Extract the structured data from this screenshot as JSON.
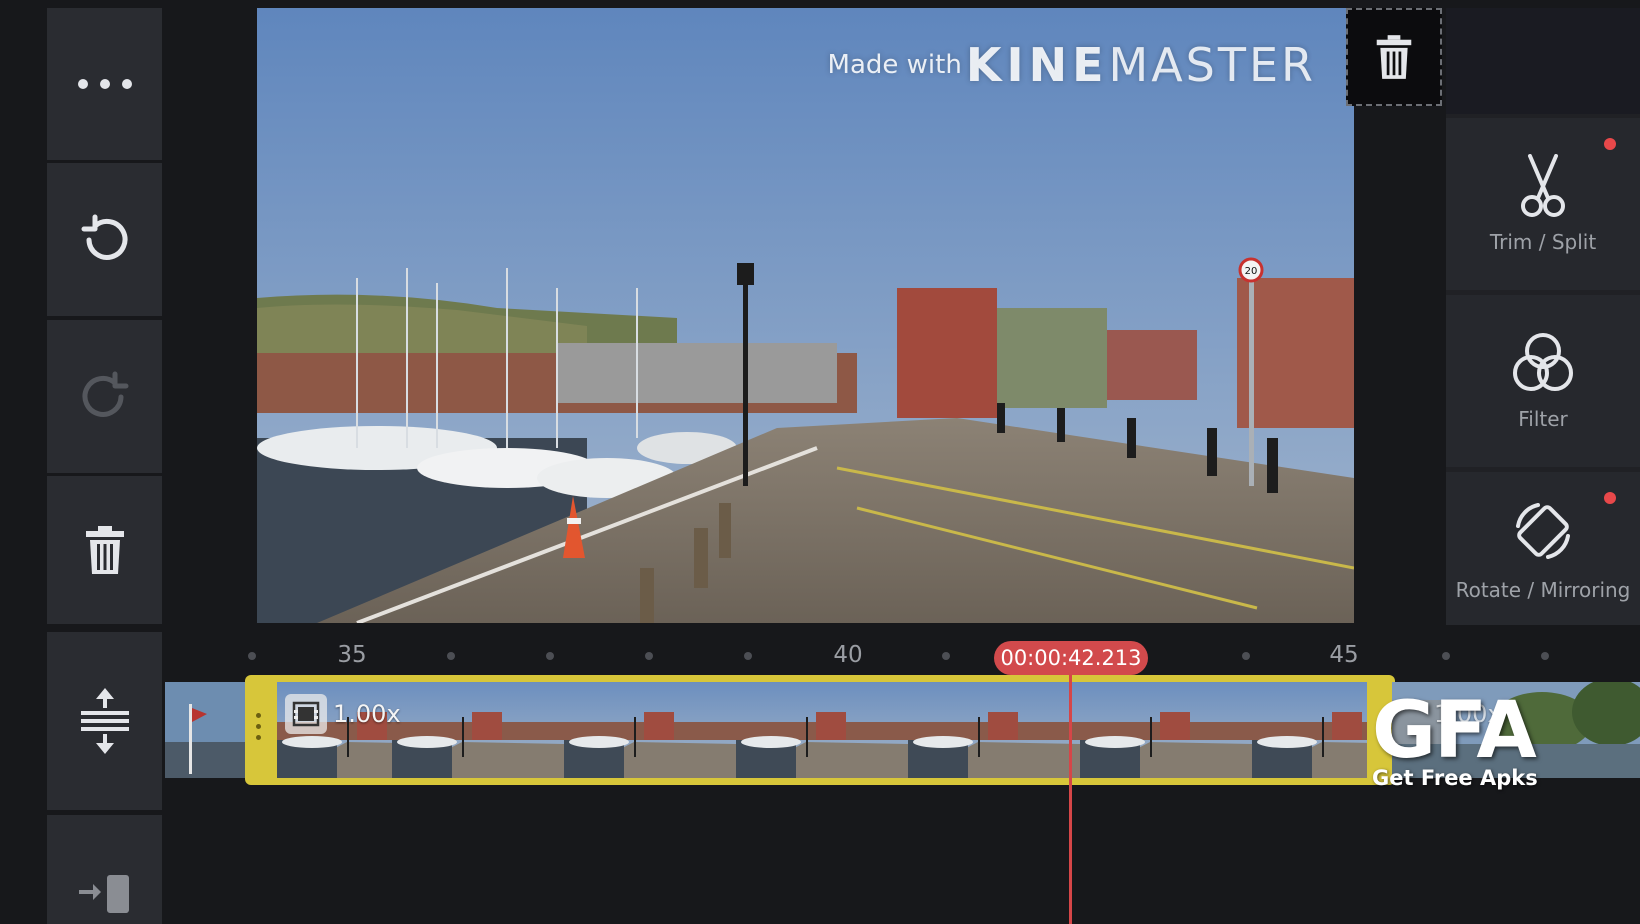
{
  "toolbar": {
    "more_icon": "ellipsis-icon",
    "undo_icon": "undo-icon",
    "redo_icon": "redo-icon",
    "delete_icon": "trash-icon",
    "expand_icon": "expand-vertical-icon",
    "export_icon": "jump-to-end-icon"
  },
  "preview": {
    "watermark_prefix": "Made with",
    "watermark_brand_bold": "KINE",
    "watermark_brand_light": "MASTER",
    "speed_sign": "20"
  },
  "popup": {
    "delete_icon": "trash-icon"
  },
  "right_panel": {
    "items": [
      {
        "label": "Trim / Split",
        "icon": "scissors-icon",
        "has_dot": true
      },
      {
        "label": "Filter",
        "icon": "filter-circles-icon",
        "has_dot": false
      },
      {
        "label": "Rotate / Mirroring",
        "icon": "rotate-icon",
        "has_dot": true
      }
    ],
    "dot_color": "#e8484a"
  },
  "timeline": {
    "ruler_labels": [
      "35",
      "40",
      "45"
    ],
    "current_time": "00:00:42.213",
    "clip_speed": "1.00x",
    "next_clip_speed": "1.00x",
    "clip_color": "#d7c63a",
    "playhead_color": "#d54648"
  },
  "overlay_logo": {
    "big": "GFA",
    "small": "Get Free Apks"
  }
}
